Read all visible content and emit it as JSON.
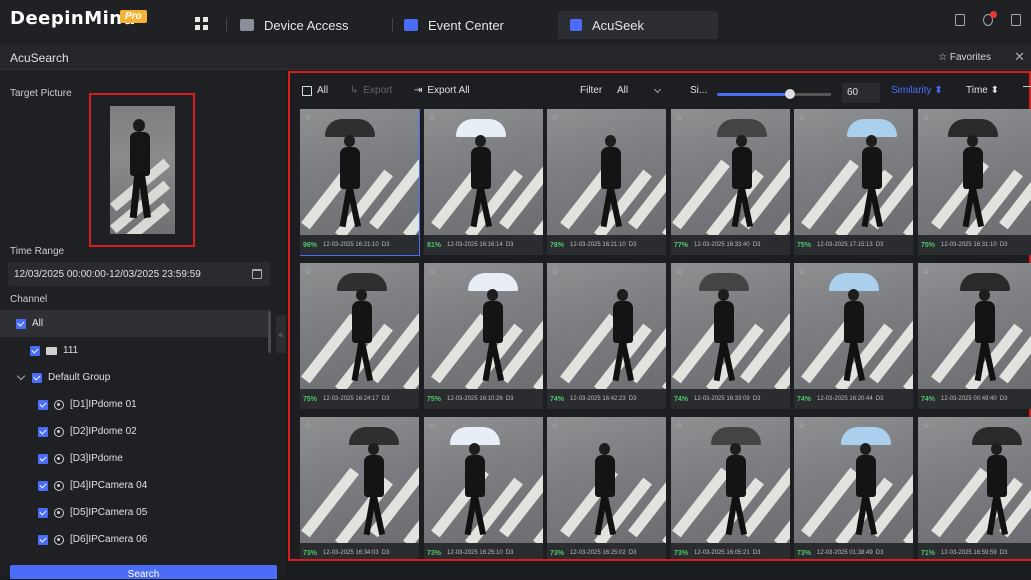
{
  "app": {
    "logo": "DeepinMind",
    "edition": "Pro",
    "tabs": [
      {
        "label": "Device Access",
        "icon": "camera-icon"
      },
      {
        "label": "Event Center",
        "icon": "event-icon"
      },
      {
        "label": "AcuSeek",
        "icon": "acuseek-icon"
      }
    ]
  },
  "subheader": {
    "title": "AcuSearch",
    "favorites": "Favorites"
  },
  "left": {
    "target_label": "Target Picture",
    "time_label": "Time Range",
    "time_value": "12/03/2025 00:00:00-12/03/2025 23:59:59",
    "channel_label": "Channel",
    "tree": [
      {
        "label": "All",
        "type": "all"
      },
      {
        "label": "111",
        "type": "folder"
      },
      {
        "label": "Default Group",
        "type": "group"
      },
      {
        "label": "[D1]IPdome 01",
        "type": "camera"
      },
      {
        "label": "[D2]IPdome 02",
        "type": "camera"
      },
      {
        "label": "[D3]IPdome",
        "type": "camera"
      },
      {
        "label": "[D4]IPCamera 04",
        "type": "camera"
      },
      {
        "label": "[D5]IPCamera 05",
        "type": "camera"
      },
      {
        "label": "[D6]IPCamera 06",
        "type": "camera"
      }
    ],
    "search_button": "Search"
  },
  "toolbar": {
    "all": "All",
    "export": "Export",
    "export_all": "Export All",
    "filter_label": "Filter",
    "filter_value": "All",
    "similarity_short": "Si...",
    "similarity_value": "60",
    "sort_similarity": "Similarity",
    "sort_time": "Time"
  },
  "results": [
    {
      "pct": "96%",
      "time": "12-03-2025 16:21:10",
      "cam": "D3"
    },
    {
      "pct": "81%",
      "time": "12-03-2025 16:16:14",
      "cam": "D3"
    },
    {
      "pct": "78%",
      "time": "12-03-2025 16:21:10",
      "cam": "D3"
    },
    {
      "pct": "77%",
      "time": "12-03-2025 16:33:40",
      "cam": "D3"
    },
    {
      "pct": "75%",
      "time": "12-03-2025 17:15:13",
      "cam": "D3"
    },
    {
      "pct": "75%",
      "time": "12-03-2025 16:31:10",
      "cam": "D3"
    },
    {
      "pct": "75%",
      "time": "12-03-2025 16:24:17",
      "cam": "D3"
    },
    {
      "pct": "75%",
      "time": "12-03-2025 16:10:26",
      "cam": "D3"
    },
    {
      "pct": "74%",
      "time": "12-03-2025 16:42:23",
      "cam": "D3"
    },
    {
      "pct": "74%",
      "time": "12-03-2025 16:33:09",
      "cam": "D3"
    },
    {
      "pct": "74%",
      "time": "12-03-2025 16:20:44",
      "cam": "D3"
    },
    {
      "pct": "74%",
      "time": "12-03-2025 00:49:40",
      "cam": "D3"
    },
    {
      "pct": "73%",
      "time": "12-03-2025 16:34:03",
      "cam": "D3"
    },
    {
      "pct": "73%",
      "time": "12-03-2025 16:25:10",
      "cam": "D3"
    },
    {
      "pct": "73%",
      "time": "12-03-2025 16:25:02",
      "cam": "D3"
    },
    {
      "pct": "73%",
      "time": "12-03-2025 16:05:21",
      "cam": "D3"
    },
    {
      "pct": "73%",
      "time": "12-03-2025 01:38:49",
      "cam": "D3"
    },
    {
      "pct": "71%",
      "time": "12-03-2025 16:59:59",
      "cam": "D3"
    }
  ],
  "colors": {
    "accent": "#4a6cf7",
    "highlight_border": "#d62020",
    "similarity_text": "#4fc76b"
  }
}
